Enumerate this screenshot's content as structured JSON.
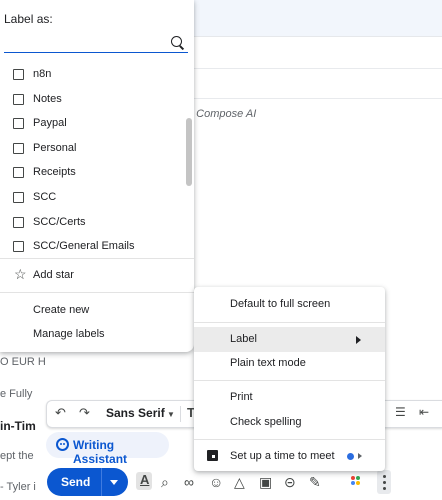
{
  "background": {
    "ai_hint": "n Compose AI",
    "frag_eur": "O EUR H",
    "frag_fully": "e Fully",
    "frag_intime": "in-Tim",
    "frag_accept": "ept the",
    "frag_tyler": "- Tyler i"
  },
  "label_menu": {
    "title": "Label as:",
    "search_placeholder": "",
    "labels": [
      "n8n",
      "Notes",
      "Paypal",
      "Personal",
      "Receipts",
      "SCC",
      "SCC/Certs",
      "SCC/General Emails"
    ],
    "add_star": "Add star",
    "create_new": "Create new",
    "manage_labels": "Manage labels"
  },
  "more_menu": {
    "default_full_screen": "Default to full screen",
    "label": "Label",
    "plain_text": "Plain text mode",
    "print": "Print",
    "check_spelling": "Check spelling",
    "schedule_meet": "Set up a time to meet"
  },
  "format_toolbar": {
    "font": "Sans Serif"
  },
  "writing_assistant": "Writing Assistant",
  "send_label": "Send",
  "colors": {
    "accent": "#0b57d0",
    "highlight": "#ebebeb",
    "assistant_bg": "#eef2fb"
  },
  "icons": [
    "search-icon",
    "checkbox-icon",
    "star-icon",
    "undo-icon",
    "redo-icon",
    "calendar-icon",
    "attach-icon",
    "link-icon",
    "emoji-icon",
    "drive-icon",
    "image-icon",
    "lock-icon",
    "signature-icon",
    "more-vert-icon"
  ]
}
